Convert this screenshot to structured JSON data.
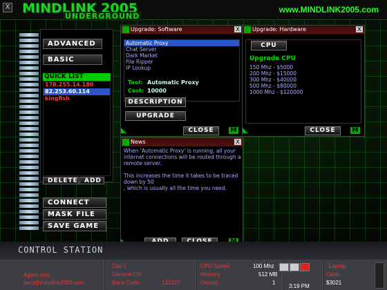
{
  "header": {
    "title": "MINDLINK 2005",
    "subtitle": "UNDERGROUND",
    "url": "www.MINDLINK2005.com",
    "close_glyph": "X"
  },
  "left": {
    "advanced_label": "ADVANCED",
    "basic_label": "BASIC",
    "quick_list_title": "QUICK LIST",
    "quick_list": [
      {
        "text": "178.255.14.180",
        "color": "#ff3b3b"
      },
      {
        "text": "82.253.60.114",
        "color": "#ffffff",
        "selected": true
      },
      {
        "text": "kingfish",
        "color": "#ff3b3b"
      }
    ],
    "delete_label": "DELETE",
    "add_label": "ADD",
    "connect_label": "CONNECT",
    "maskfile_label": "MASK FILE",
    "savegame_label": "SAVE GAME"
  },
  "software_window": {
    "title": "Upgrade: Software",
    "items": [
      "Automatic Proxy",
      "Chat Server",
      "Dark Market",
      "File Ripper",
      "IP Lookup"
    ],
    "selected_index": 0,
    "tool_label": "Tool:",
    "tool_value": "Automatic Proxy",
    "cost_label": "Cost:",
    "cost_value": "10000",
    "description_label": "DESCRIPTION",
    "upgrade_label": "UPGRADE",
    "close_label": "CLOSE",
    "m_label": "M",
    "x_label": "X"
  },
  "hardware_window": {
    "title": "Upgrade: Hardware",
    "cpu_button": "CPU",
    "upgrade_title": "Upgrade CPU",
    "options": [
      "150 Mhz - $5000",
      "200 Mhz - $15000",
      "300 Mhz - $40000",
      "500 Mhz - $80000",
      "1000 Mhz - $120000"
    ],
    "close_label": "CLOSE",
    "m_label": "M",
    "x_label": "X"
  },
  "news_window": {
    "title": "News",
    "lines": [
      "When 'Automatic Proxy' is running, all your",
      "internet connections will be routed through a",
      "remote server.",
      "",
      "This increases the time it takes to be traced",
      "down by 50",
      ", which is usually all the time you need."
    ],
    "add_label": "ADD",
    "close_label": "CLOSE",
    "m_label": "M",
    "x_label": "X"
  },
  "station_label": "CONTROL STATION",
  "status": {
    "agent": "Agent zero",
    "email": "zero@mindlink2005.com",
    "day": "Day 1",
    "city": "Geneva-CH",
    "bank_label": "Bank Code",
    "bank_code": "13102?",
    "cpu_label": "CPU Speed",
    "cpu_value": "100 Mhz",
    "memory_label": "Memory",
    "memory_value": "512 MB",
    "owned_label": "Owned",
    "owned_value": "1",
    "time": "3:19 PM",
    "laptop_label": "Laptop",
    "cash_label": "Cash...",
    "cash_value": "$3021"
  }
}
